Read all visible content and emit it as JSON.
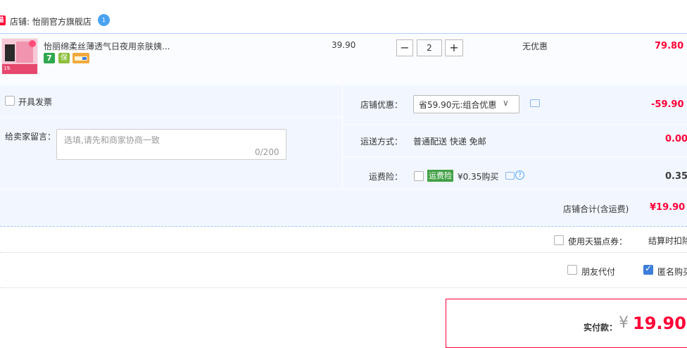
{
  "store": {
    "logo_text": "猫",
    "label": "店铺: 怡丽官方旗舰店",
    "ww_badge": "1"
  },
  "item": {
    "title": "怡丽绵柔丝薄透气日夜用亲肤姨...",
    "thumb_tag": "19.",
    "service_icons": [
      "7",
      "保",
      "card"
    ],
    "unit_price": "39.90",
    "quantity": "2",
    "minus_label": "−",
    "plus_label": "+",
    "discount": "无优惠",
    "subtotal": "79.80"
  },
  "options": {
    "invoice_label": "开具发票",
    "message_label": "给卖家留言：",
    "message_placeholder": "选填,请先和商家协商一致",
    "message_count": "0/200",
    "store_discount_label": "店铺优惠：",
    "store_discount_select": "省59.90元:组合优惠",
    "store_discount_chevron": "∨",
    "store_discount_value": "-59.90",
    "shipping_label": "运送方式：",
    "shipping_method": "普通配送 快递 免邮",
    "shipping_price": "0.00",
    "insurance_label": "运费险：",
    "insurance_badge": "运费险",
    "insurance_price": "¥0.35购买",
    "insurance_help": "?",
    "insurance_value": "0.35"
  },
  "summary": {
    "store_total_label": "店铺合计(含运费)",
    "store_total_value": "¥19.90",
    "points_label": "使用天猫点券：",
    "points_note": "结算时扣除",
    "friend_pay_label": "朋友代付",
    "anonymous_label": "匿名购买",
    "anonymous_checked": true,
    "pay_label": "实付款：",
    "pay_currency": "¥",
    "pay_value": "19.90"
  },
  "colors": {
    "accent": "#ff0036",
    "panel": "#f2f7ff",
    "border_blue": "#b2d1ff",
    "check_blue": "#3d7edb"
  }
}
